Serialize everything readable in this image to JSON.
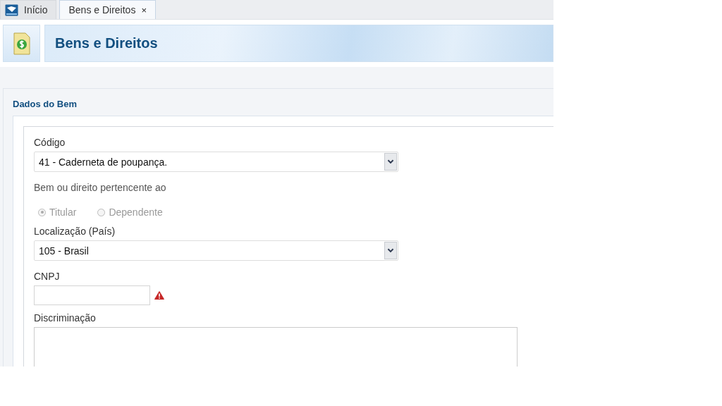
{
  "tabs": [
    {
      "label": "Início",
      "selected": false,
      "kind": "home"
    },
    {
      "label": "Bens e Direitos",
      "selected": true,
      "kind": "page",
      "close": "×"
    }
  ],
  "header": {
    "title": "Bens e Direitos"
  },
  "section": {
    "title": "Dados do Bem"
  },
  "fields": [
    {
      "kind": "select",
      "label": "Código",
      "value": "41 - Caderneta de poupança."
    },
    {
      "kind": "radio",
      "label": "Bem ou direito pertencente ao",
      "options": [
        {
          "label": "Titular",
          "selected": true,
          "disabled": true
        },
        {
          "label": "Dependente",
          "selected": false,
          "disabled": true
        }
      ]
    },
    {
      "kind": "select",
      "label": "Localização (País)",
      "value": "105 - Brasil"
    },
    {
      "kind": "text",
      "label": "CNPJ",
      "invalid": true
    },
    {
      "kind": "textarea",
      "label": "Discriminação"
    }
  ]
}
